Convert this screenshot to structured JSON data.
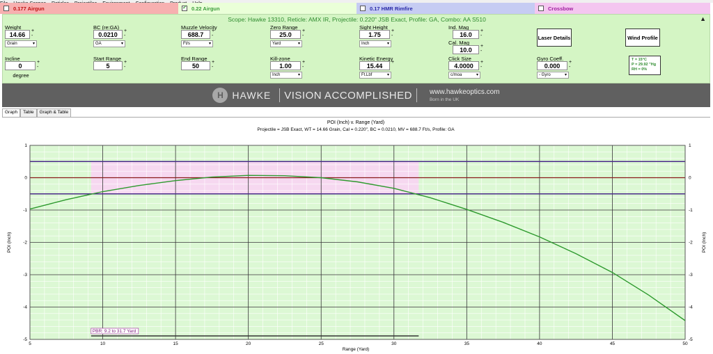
{
  "tabs": [
    {
      "label": "0.177 Airgun",
      "checked": false
    },
    {
      "label": "0.22 Airgun",
      "checked": true
    },
    {
      "label": "0.17 HMR Rimfire",
      "checked": false
    },
    {
      "label": "Crossbow",
      "checked": false
    }
  ],
  "scope_line": "Scope: Hawke 13310, Reticle: AMX IR, Projectile: 0.220\" JSB Exact, Profile: GA, Combo: AA S510",
  "fields": {
    "weight": {
      "label": "Weight",
      "value": "14.66",
      "unit": "Grain"
    },
    "bc": {
      "label": "BC (re:GA)",
      "value": "0.0210",
      "unit": "GA"
    },
    "muzzle_velocity": {
      "label": "Muzzle Velocity",
      "value": "688.7",
      "unit": "Ft/s"
    },
    "zero_range": {
      "label": "Zero Range",
      "value": "25.0",
      "unit": "Yard"
    },
    "sight_height": {
      "label": "Sight Height",
      "value": "1.75",
      "unit": "Inch"
    },
    "ind_mag": {
      "label": "Ind. Mag",
      "value": "16.0"
    },
    "cal_mag": {
      "label": "Cal. Mag",
      "value": "10.0"
    },
    "incline": {
      "label": "Incline",
      "value": "0",
      "unit": "degree"
    },
    "start_range": {
      "label": "Start Range",
      "value": "5"
    },
    "end_range": {
      "label": "End Range",
      "value": "50"
    },
    "kill_zone": {
      "label": "Kill-zone",
      "value": "1.00",
      "unit": "Inch"
    },
    "kinetic_energy": {
      "label": "Kinetic Energy",
      "value": "15.44",
      "unit": "Ft.Lbf"
    },
    "click_size": {
      "label": "Click Size",
      "value": "4.0000",
      "unit": "c/moa"
    },
    "gyro_coeff": {
      "label": "Gyro Coeff.",
      "value": "0.000",
      "unit": "- Gyro"
    }
  },
  "buttons": {
    "laser_details": "Laser Details",
    "wind_profile": "Wind Profile"
  },
  "environment": {
    "temp": "T = 15°C",
    "pressure": "P = 29.92 \"Hg",
    "humidity": "RH = 0%"
  },
  "banner": {
    "brand": "HAWKE",
    "tagline": "VISION ACCOMPLISHED",
    "url": "www.hawkeoptics.com",
    "born": "Born in the UK"
  },
  "view_tabs": [
    "Graph",
    "Table",
    "Graph & Table"
  ],
  "menu_items": [
    "File",
    "Hawke Scopes",
    "Reticles",
    "Projectiles",
    "Environment",
    "Configuration",
    "Product",
    "Help"
  ],
  "chart_data": {
    "type": "line",
    "title": "POI (Inch) v. Range (Yard)",
    "subtitle": "Projectile = JSB Exact, WT = 14.66 Grain, Cal = 0.220\", BC = 0.0210, MV = 688.7 Ft/s, Profile: GA",
    "xlabel": "Range (Yard)",
    "ylabel": "POI (Inch)",
    "xlim": [
      5,
      50
    ],
    "ylim": [
      -5,
      1
    ],
    "xticks": [
      5,
      10,
      15,
      20,
      25,
      30,
      35,
      40,
      45,
      50
    ],
    "yticks": [
      1,
      0,
      -1,
      -2,
      -3,
      -4,
      -5
    ],
    "grid": true,
    "kill_zone": [
      -0.5,
      0.5
    ],
    "pbr_range": [
      9.2,
      31.7
    ],
    "pbr_label": "PBR: 9.2 to 31.7 Yard",
    "series": [
      {
        "color": "#2e9a2e",
        "x": [
          5,
          7.5,
          10,
          12.5,
          15,
          17.5,
          20,
          22.5,
          25,
          27.5,
          30,
          32.5,
          35,
          37.5,
          40,
          42.5,
          45,
          47.5,
          50
        ],
        "y": [
          -0.97,
          -0.68,
          -0.43,
          -0.24,
          -0.09,
          0.02,
          0.07,
          0.06,
          0.0,
          -0.13,
          -0.33,
          -0.62,
          -0.98,
          -1.38,
          -1.83,
          -2.35,
          -2.93,
          -3.63,
          -4.42
        ]
      }
    ]
  }
}
